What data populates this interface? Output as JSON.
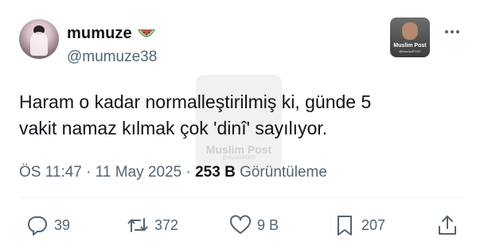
{
  "author": {
    "display_name": "mumuze",
    "emoji_icon": "watermelon-icon",
    "handle": "@mumuze38"
  },
  "corner_badge": {
    "brand": "Muslim Post",
    "sub": "@MuslimPOST"
  },
  "watermark": {
    "brand": "Muslim Post",
    "sub": "@MuslimPOST"
  },
  "tweet": {
    "text_line1": "Haram o kadar normalleştirilmiş ki, günde 5",
    "text_line2": "vakit namaz kılmak çok 'dinî' sayılıyor."
  },
  "meta": {
    "time": "ÖS 11:47",
    "sep1": " · ",
    "date": "11 May 2025",
    "sep2": " · ",
    "views_count": "253 B",
    "views_label": " Görüntüleme"
  },
  "actions": {
    "replies": "39",
    "reposts": "372",
    "likes": "9 B",
    "bookmarks": "207"
  },
  "colors": {
    "text": "#0f1419",
    "secondary": "#536471",
    "divider": "#eff3f4"
  }
}
